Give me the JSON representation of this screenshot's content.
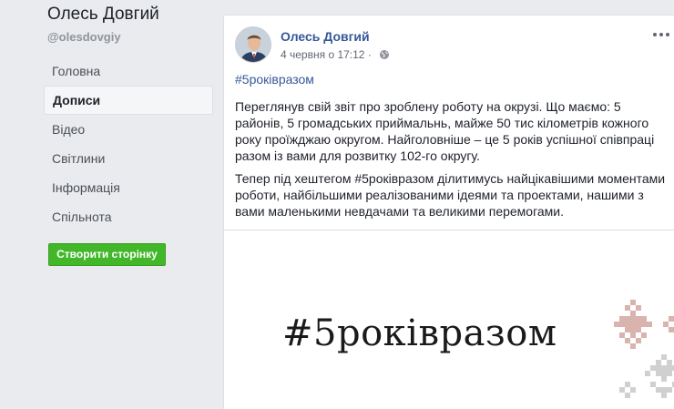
{
  "page": {
    "name": "Олесь Довгий",
    "handle": "@olesdovgiy"
  },
  "nav": {
    "items": [
      {
        "label": "Головна"
      },
      {
        "label": "Дописи"
      },
      {
        "label": "Відео"
      },
      {
        "label": "Світлини"
      },
      {
        "label": "Інформація"
      },
      {
        "label": "Спільнота"
      }
    ],
    "active": "Дописи"
  },
  "create_page_button": "Створити сторінку",
  "post": {
    "author": "Олесь Довгий",
    "timestamp": "4 червня о 17:12",
    "dot": "·",
    "hashtag": "#5роківразом",
    "paragraph1": "Переглянув свій звіт про зроблену роботу на окрузі. Що маємо: 5 районів, 5 громадських приймальнь, майже 50 тис кілометрів кожного року проїжджаю округом. Найголовніше – це 5 років успішної співпраці разом із вами для розвитку 102-го округу.",
    "paragraph2": "Тепер під хештегом #5роківразом ділитимусь найцікавішими моментами роботи, найбільшими реалізованими ідеями та проектами, нашими з вами маленькими невдачами та великими перемогами.",
    "image_text": "#5роківразом"
  },
  "colors": {
    "link": "#365899",
    "button_green": "#42b72a",
    "ornament_pink": "#d9b3ad",
    "ornament_gray": "#d0d0d0"
  }
}
